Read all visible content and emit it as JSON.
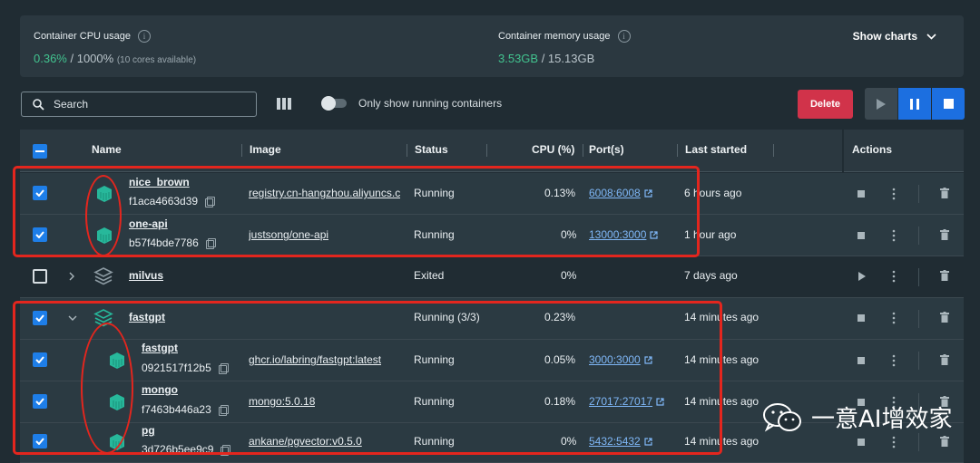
{
  "usage": {
    "cpu_title": "Container CPU usage",
    "cpu_value": "0.36%",
    "cpu_total": " / 1000%",
    "cpu_sub": "(10 cores available)",
    "mem_title": "Container memory usage",
    "mem_value": "3.53GB",
    "mem_total": " / 15.13GB",
    "show_charts": "Show charts"
  },
  "toolbar": {
    "search_placeholder": "Search",
    "toggle_label": "Only show running containers",
    "delete_label": "Delete"
  },
  "table": {
    "headers": {
      "name": "Name",
      "image": "Image",
      "status": "Status",
      "cpu": "CPU (%)",
      "ports": "Port(s)",
      "last_started": "Last started",
      "actions": "Actions"
    },
    "rows": [
      {
        "name": "nice_brown",
        "id": "f1aca4663d39",
        "image": "registry.cn-hangzhou.aliyuncs.c",
        "status": "Running",
        "cpu": "0.13%",
        "port": "6008:6008",
        "last": "6 hours ago"
      },
      {
        "name": "one-api",
        "id": "b57f4bde7786",
        "image": "justsong/one-api",
        "status": "Running",
        "cpu": "0%",
        "port": "13000:3000",
        "last": "1 hour ago"
      },
      {
        "name": "milvus",
        "id": "",
        "image": "",
        "status": "Exited",
        "cpu": "0%",
        "port": "",
        "last": "7 days ago"
      },
      {
        "name": "fastgpt",
        "id": "",
        "image": "",
        "status": "Running (3/3)",
        "cpu": "0.23%",
        "port": "",
        "last": "14 minutes ago"
      },
      {
        "name": "fastgpt",
        "id": "0921517f12b5",
        "image": "ghcr.io/labring/fastgpt:latest",
        "status": "Running",
        "cpu": "0.05%",
        "port": "3000:3000",
        "last": "14 minutes ago"
      },
      {
        "name": "mongo",
        "id": "f7463b446a23",
        "image": "mongo:5.0.18",
        "status": "Running",
        "cpu": "0.18%",
        "port": "27017:27017",
        "last": "14 minutes ago"
      },
      {
        "name": "pg",
        "id": "3d726b5ee9c9",
        "image": "ankane/pgvector:v0.5.0",
        "status": "Running",
        "cpu": "0%",
        "port": "5432:5432",
        "last": "14 minutes ago"
      }
    ]
  },
  "watermark": "一意AI增效家",
  "colors": {
    "accent": "#1e7ee8",
    "link": "#7fb7f7",
    "danger": "#d1334a",
    "green": "#42c38f",
    "annotation": "#e3261e"
  }
}
